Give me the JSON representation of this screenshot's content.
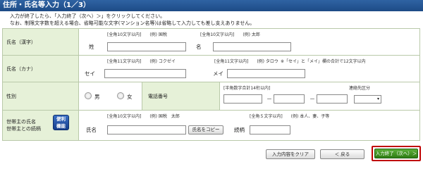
{
  "header": {
    "title": "住所・氏名等入力（1／3）"
  },
  "instructions": [
    "入力が終了したら、「入力終了（次へ）＞」をクリックしてください。",
    "なお、制限文字数を超える場合、省略可能な文字(マンション名等)は省略して入力しても差し支えありません。"
  ],
  "name_kanji": {
    "label": "氏名（漢字）",
    "sei_hint": "[全角10文字以内]　　(例) 国税",
    "sei_label": "姓",
    "sei_value": "",
    "mei_hint": "[全角10文字以内]　　(例) 太郎",
    "mei_label": "名",
    "mei_value": ""
  },
  "name_kana": {
    "label": "氏名（カナ）",
    "sei_hint": "[全角11文字以内]　　(例) コクゼイ",
    "sei_label": "セイ",
    "sei_value": "",
    "mei_hint": "[全角11文字以内]　　(例) タロウ",
    "mei_label": "メイ",
    "mei_value": "",
    "note": "※「セイ」と「メイ」欄の合計で12文字以内"
  },
  "gender": {
    "label": "性別",
    "male": "男",
    "female": "女"
  },
  "phone": {
    "label": "電話番号",
    "hint": "[半角数字合計14桁以内]",
    "contact_label": "連絡先区分",
    "contact_value": ""
  },
  "householder": {
    "label_line1": "世帯主の氏名",
    "label_line2": "世帯主との続柄",
    "help_line1": "便利",
    "help_line2": "機能",
    "name_hint": "[全角10文字以内]　　(例) 国税　太郎",
    "name_label": "氏名",
    "name_value": "",
    "copy_button": "氏名をコピー",
    "relation_hint": "[全角５文字以内]　　(例) 本人、妻、子等",
    "relation_label": "続柄",
    "relation_value": ""
  },
  "footer": {
    "clear_button": "入力内容をクリア",
    "back_button": "＜ 戻る",
    "next_button": "入力終了（次へ）＞"
  }
}
